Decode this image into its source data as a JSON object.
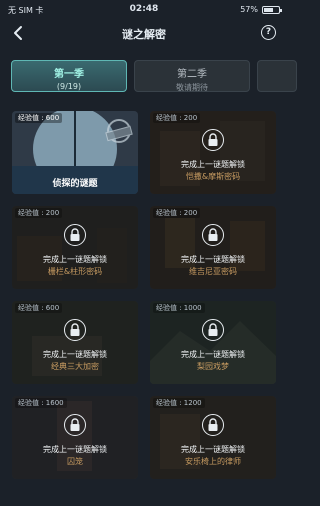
{
  "status": {
    "carrier": "无 SIM 卡",
    "time": "02:48",
    "battery": "57%"
  },
  "nav": {
    "title": "谜之解密"
  },
  "tabs": [
    {
      "title": "第一季",
      "sub": "(9/19)"
    },
    {
      "title": "第二季",
      "sub": "敬请期待"
    }
  ],
  "cards": [
    {
      "exp": "经验值 : 600",
      "name": "侦探的谜题",
      "locked": false
    },
    {
      "exp": "经验值 : 200",
      "msg": "完成上一谜题解锁",
      "name": "恺撒&摩斯密码",
      "locked": true
    },
    {
      "exp": "经验值 : 200",
      "msg": "完成上一谜题解锁",
      "name": "栅栏&柱形密码",
      "locked": true
    },
    {
      "exp": "经验值 : 200",
      "msg": "完成上一谜题解锁",
      "name": "维吉尼亚密码",
      "locked": true
    },
    {
      "exp": "经验值 : 600",
      "msg": "完成上一谜题解锁",
      "name": "经典三大加密",
      "locked": true
    },
    {
      "exp": "经验值 : 1000",
      "msg": "完成上一谜题解锁",
      "name": "梨园戏梦",
      "locked": true
    },
    {
      "exp": "经验值 : 1600",
      "msg": "完成上一谜题解锁",
      "name": "囚笼",
      "locked": true
    },
    {
      "exp": "经验值 : 1200",
      "msg": "完成上一谜题解锁",
      "name": "安乐椅上的律师",
      "locked": true
    }
  ]
}
